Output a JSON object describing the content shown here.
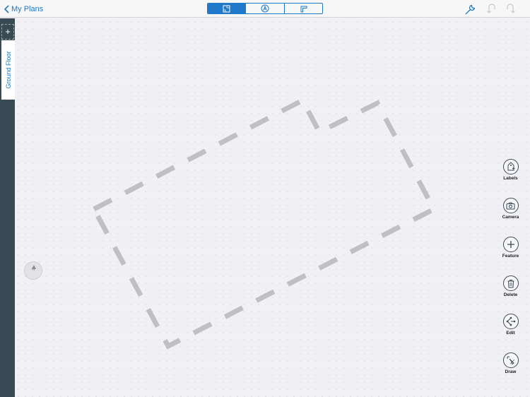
{
  "header": {
    "back_label": "My Plans",
    "view_modes": [
      {
        "name": "plan-view",
        "icon": "plan-icon",
        "active": true
      },
      {
        "name": "label-view",
        "icon": "label-view-icon",
        "active": false
      },
      {
        "name": "wall-view",
        "icon": "wall-corner-icon",
        "active": false
      }
    ],
    "tools": [
      "wrench-icon",
      "undo-icon",
      "redo-icon"
    ],
    "accent_color": "#1f78c8"
  },
  "floors": {
    "add_label": "+",
    "current": "Ground Floor"
  },
  "compass": {
    "label": "N"
  },
  "right_toolbar": [
    {
      "label": "Labels",
      "icon": "tag-add-icon"
    },
    {
      "label": "Camera",
      "icon": "camera-icon"
    },
    {
      "label": "Feature",
      "icon": "plus-icon"
    },
    {
      "label": "Delete",
      "icon": "trash-icon"
    },
    {
      "label": "Edit",
      "icon": "edit-nodes-icon"
    },
    {
      "label": "Draw",
      "icon": "draw-pen-icon"
    }
  ]
}
